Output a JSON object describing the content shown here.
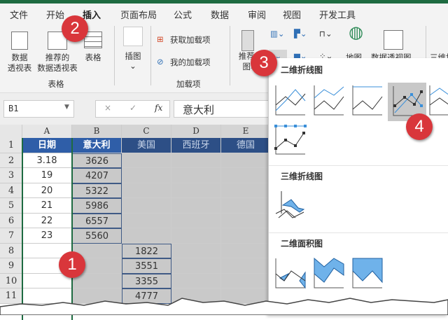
{
  "tabs": [
    "文件",
    "开始",
    "插入",
    "页面布局",
    "公式",
    "数据",
    "审阅",
    "视图",
    "开发工具"
  ],
  "active_tab": "插入",
  "ribbon": {
    "pivot_table": "数据\n透视表",
    "recommended_pivot": "推荐的\n数据透视表",
    "table": "表格",
    "group_tables": "表格",
    "illustrations": "插图",
    "get_addins": "获取加载项",
    "my_addins": "我的加载项",
    "group_addins": "加载项",
    "recommended_charts": "推荐的\n图表",
    "maps": "地图",
    "pivot_chart": "数据透视图",
    "map_3d": "三维地图"
  },
  "formula_bar": {
    "name_box": "B1",
    "cancel": "×",
    "enter": "✓",
    "fx": "fx",
    "value": "意大利"
  },
  "columns": [
    "A",
    "B",
    "C",
    "D",
    "E"
  ],
  "rows": [
    "1",
    "2",
    "3",
    "4",
    "5",
    "6",
    "7",
    "8",
    "9",
    "10",
    "11"
  ],
  "cells": {
    "A": [
      "日期",
      "3.18",
      "19",
      "20",
      "21",
      "22",
      "23",
      "",
      "",
      "",
      ""
    ],
    "B": [
      "意大利",
      "3626",
      "4207",
      "5322",
      "5986",
      "6557",
      "5560",
      "",
      "",
      "",
      ""
    ],
    "C": [
      "美国",
      "",
      "",
      "",
      "",
      "",
      "",
      "1822",
      "3551",
      "3355",
      "4777"
    ],
    "D": [
      "西班牙",
      "",
      "",
      "",
      "",
      "",
      "",
      "",
      "",
      "",
      ""
    ],
    "E": [
      "德国",
      "",
      "",
      "",
      "",
      "",
      "",
      "",
      "",
      "",
      ""
    ]
  },
  "dropdown": {
    "section_2d_line": "二维折线图",
    "section_3d_line": "三维折线图",
    "section_2d_area": "二维面积图"
  },
  "badges": [
    "1",
    "2",
    "3",
    "4"
  ],
  "colors": {
    "accent": "#1e6b41",
    "header": "#2f5ea8",
    "badge": "#d9363b",
    "series": "#3a8fd9"
  }
}
